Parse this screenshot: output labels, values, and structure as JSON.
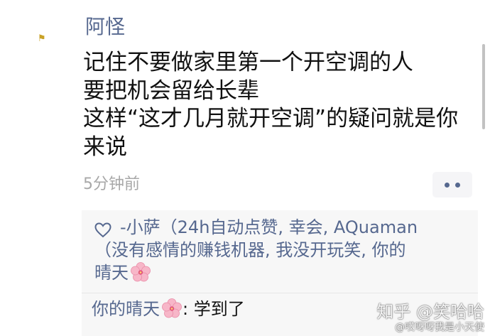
{
  "post": {
    "author": "阿怪",
    "lines": [
      "记住不要做家里第一个开空调的人",
      "要把机会留给长辈",
      "这样“这才几月就开空调”的疑问就是你",
      "来说"
    ],
    "timestamp": "5分钟前"
  },
  "likes": {
    "line1": "-小萨（24h自动点赞, 幸会, AQuaman",
    "line2": "（没有感情的赚钱机器, 我没开玩笑, 你的",
    "line3": "晴天"
  },
  "comment": {
    "author": "你的晴天",
    "separator": ": ",
    "text": "学到了"
  },
  "watermark": {
    "main": "知乎 @笑哈哈",
    "sub": "@哎呀呀我是小天使"
  },
  "colors": {
    "name_link": "#56688f",
    "text": "#111111",
    "muted": "#a8a8a8",
    "panel_bg": "#f7f7f7"
  },
  "icons": {
    "like": "heart-outline-icon",
    "emoji": "cherry-blossom-icon",
    "menu": "more-dots-icon"
  }
}
